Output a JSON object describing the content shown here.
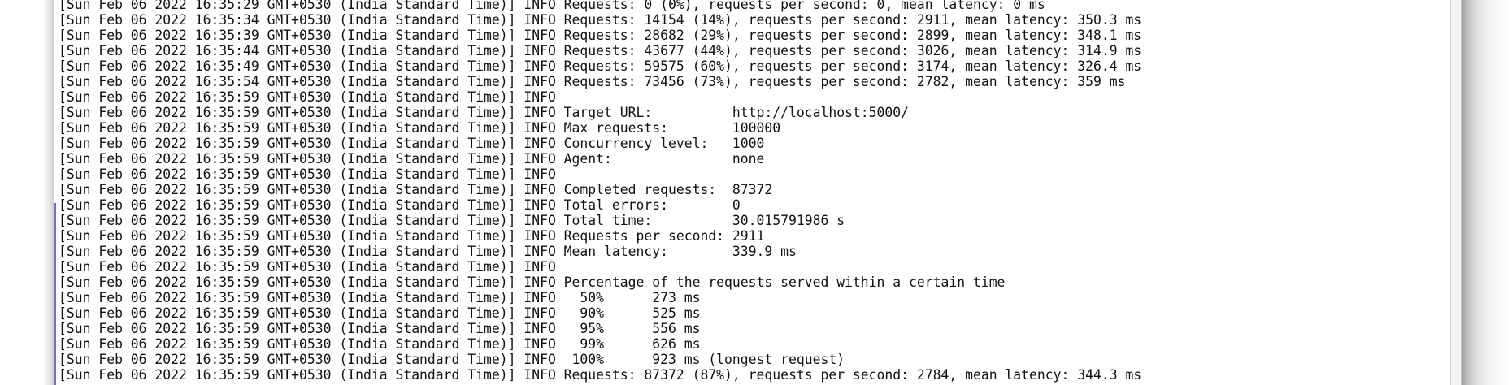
{
  "terminal": {
    "lines": [
      "[Sun Feb 06 2022 16:35:29 GMT+0530 (India Standard Time)] INFO Requests: 0 (0%), requests per second: 0, mean latency: 0 ms",
      "[Sun Feb 06 2022 16:35:34 GMT+0530 (India Standard Time)] INFO Requests: 14154 (14%), requests per second: 2911, mean latency: 350.3 ms",
      "[Sun Feb 06 2022 16:35:39 GMT+0530 (India Standard Time)] INFO Requests: 28682 (29%), requests per second: 2899, mean latency: 348.1 ms",
      "[Sun Feb 06 2022 16:35:44 GMT+0530 (India Standard Time)] INFO Requests: 43677 (44%), requests per second: 3026, mean latency: 314.9 ms",
      "[Sun Feb 06 2022 16:35:49 GMT+0530 (India Standard Time)] INFO Requests: 59575 (60%), requests per second: 3174, mean latency: 326.4 ms",
      "[Sun Feb 06 2022 16:35:54 GMT+0530 (India Standard Time)] INFO Requests: 73456 (73%), requests per second: 2782, mean latency: 359 ms",
      "[Sun Feb 06 2022 16:35:59 GMT+0530 (India Standard Time)] INFO",
      "[Sun Feb 06 2022 16:35:59 GMT+0530 (India Standard Time)] INFO Target URL:          http://localhost:5000/",
      "[Sun Feb 06 2022 16:35:59 GMT+0530 (India Standard Time)] INFO Max requests:        100000",
      "[Sun Feb 06 2022 16:35:59 GMT+0530 (India Standard Time)] INFO Concurrency level:   1000",
      "[Sun Feb 06 2022 16:35:59 GMT+0530 (India Standard Time)] INFO Agent:               none",
      "[Sun Feb 06 2022 16:35:59 GMT+0530 (India Standard Time)] INFO",
      "[Sun Feb 06 2022 16:35:59 GMT+0530 (India Standard Time)] INFO Completed requests:  87372",
      "[Sun Feb 06 2022 16:35:59 GMT+0530 (India Standard Time)] INFO Total errors:        0",
      "[Sun Feb 06 2022 16:35:59 GMT+0530 (India Standard Time)] INFO Total time:          30.015791986 s",
      "[Sun Feb 06 2022 16:35:59 GMT+0530 (India Standard Time)] INFO Requests per second: 2911",
      "[Sun Feb 06 2022 16:35:59 GMT+0530 (India Standard Time)] INFO Mean latency:        339.9 ms",
      "[Sun Feb 06 2022 16:35:59 GMT+0530 (India Standard Time)] INFO",
      "[Sun Feb 06 2022 16:35:59 GMT+0530 (India Standard Time)] INFO Percentage of the requests served within a certain time",
      "[Sun Feb 06 2022 16:35:59 GMT+0530 (India Standard Time)] INFO   50%      273 ms",
      "[Sun Feb 06 2022 16:35:59 GMT+0530 (India Standard Time)] INFO   90%      525 ms",
      "[Sun Feb 06 2022 16:35:59 GMT+0530 (India Standard Time)] INFO   95%      556 ms",
      "[Sun Feb 06 2022 16:35:59 GMT+0530 (India Standard Time)] INFO   99%      626 ms",
      "[Sun Feb 06 2022 16:35:59 GMT+0530 (India Standard Time)] INFO  100%      923 ms (longest request)",
      "[Sun Feb 06 2022 16:35:59 GMT+0530 (India Standard Time)] INFO Requests: 87372 (87%), requests per second: 2784, mean latency: 344.3 ms"
    ]
  }
}
